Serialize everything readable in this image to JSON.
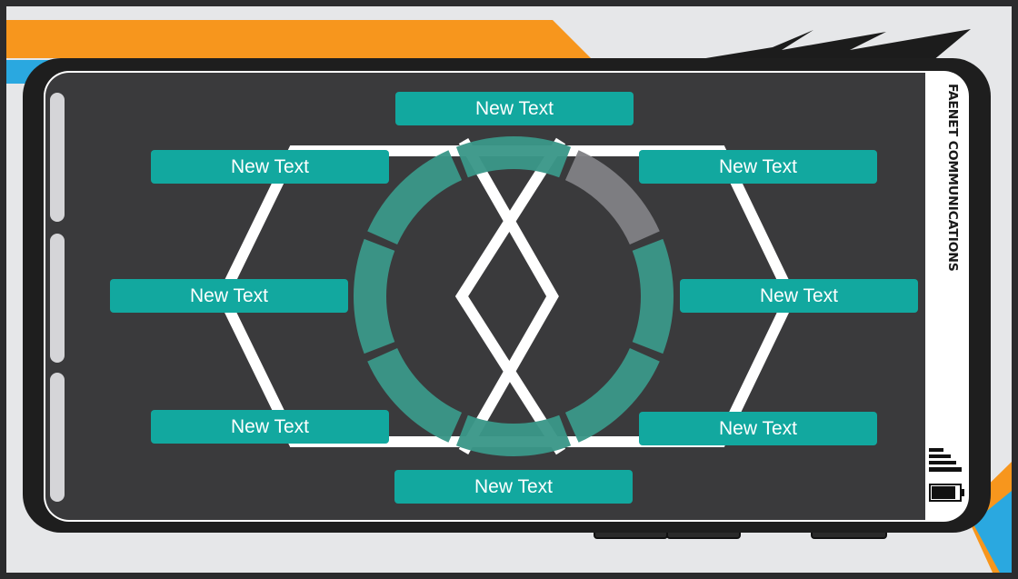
{
  "device": {
    "brand": "FAENET COMMUNICATIONS"
  },
  "wheel": {
    "segments": [
      {
        "name": "segment-top",
        "highlighted": false
      },
      {
        "name": "segment-top-right",
        "highlighted": true
      },
      {
        "name": "segment-right-upper",
        "highlighted": false
      },
      {
        "name": "segment-right-lower",
        "highlighted": false
      },
      {
        "name": "segment-bottom",
        "highlighted": false
      },
      {
        "name": "segment-bottom-left",
        "highlighted": false
      },
      {
        "name": "segment-left-lower",
        "highlighted": false
      },
      {
        "name": "segment-left-upper",
        "highlighted": false
      }
    ],
    "labels": {
      "top": "New Text",
      "top_left": "New Text",
      "top_right": "New Text",
      "left": "New Text",
      "right": "New Text",
      "bottom_left": "New Text",
      "bottom_right": "New Text",
      "bottom": "New Text"
    }
  },
  "status": {
    "signal_icon": "signal-bars-icon",
    "battery_icon": "battery-icon"
  },
  "colors": {
    "accent": "#12a89f",
    "segment": "#3a9788",
    "segment_highlight": "#808084",
    "screen": "#3a3a3c",
    "stripe_orange": "#f7961d",
    "stripe_blue": "#2aa8e0"
  }
}
